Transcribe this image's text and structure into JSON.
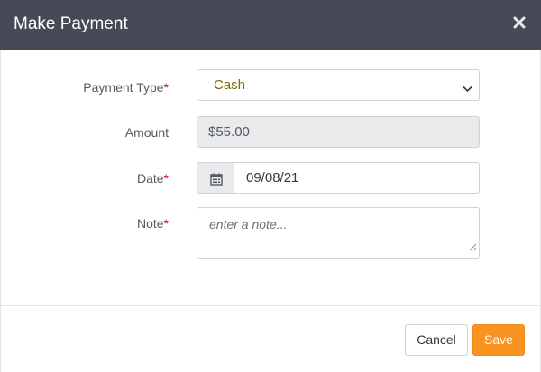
{
  "header": {
    "title": "Make Payment",
    "close_icon": "close-icon"
  },
  "form": {
    "payment_type": {
      "label": "Payment Type",
      "required_mark": "*",
      "value": "Cash",
      "chevron_icon": "chevron-down-icon"
    },
    "amount": {
      "label": "Amount",
      "value": "$55.00"
    },
    "date": {
      "label": "Date",
      "required_mark": "*",
      "value": "09/08/21",
      "calendar_icon": "calendar-icon"
    },
    "note": {
      "label": "Note",
      "required_mark": "*",
      "placeholder": "enter a note..."
    }
  },
  "footer": {
    "cancel_label": "Cancel",
    "save_label": "Save"
  },
  "colors": {
    "header_bg": "#454a56",
    "save_bg": "#f7931e",
    "required": "#d0021b",
    "disabled_bg": "#e9eaeb"
  }
}
